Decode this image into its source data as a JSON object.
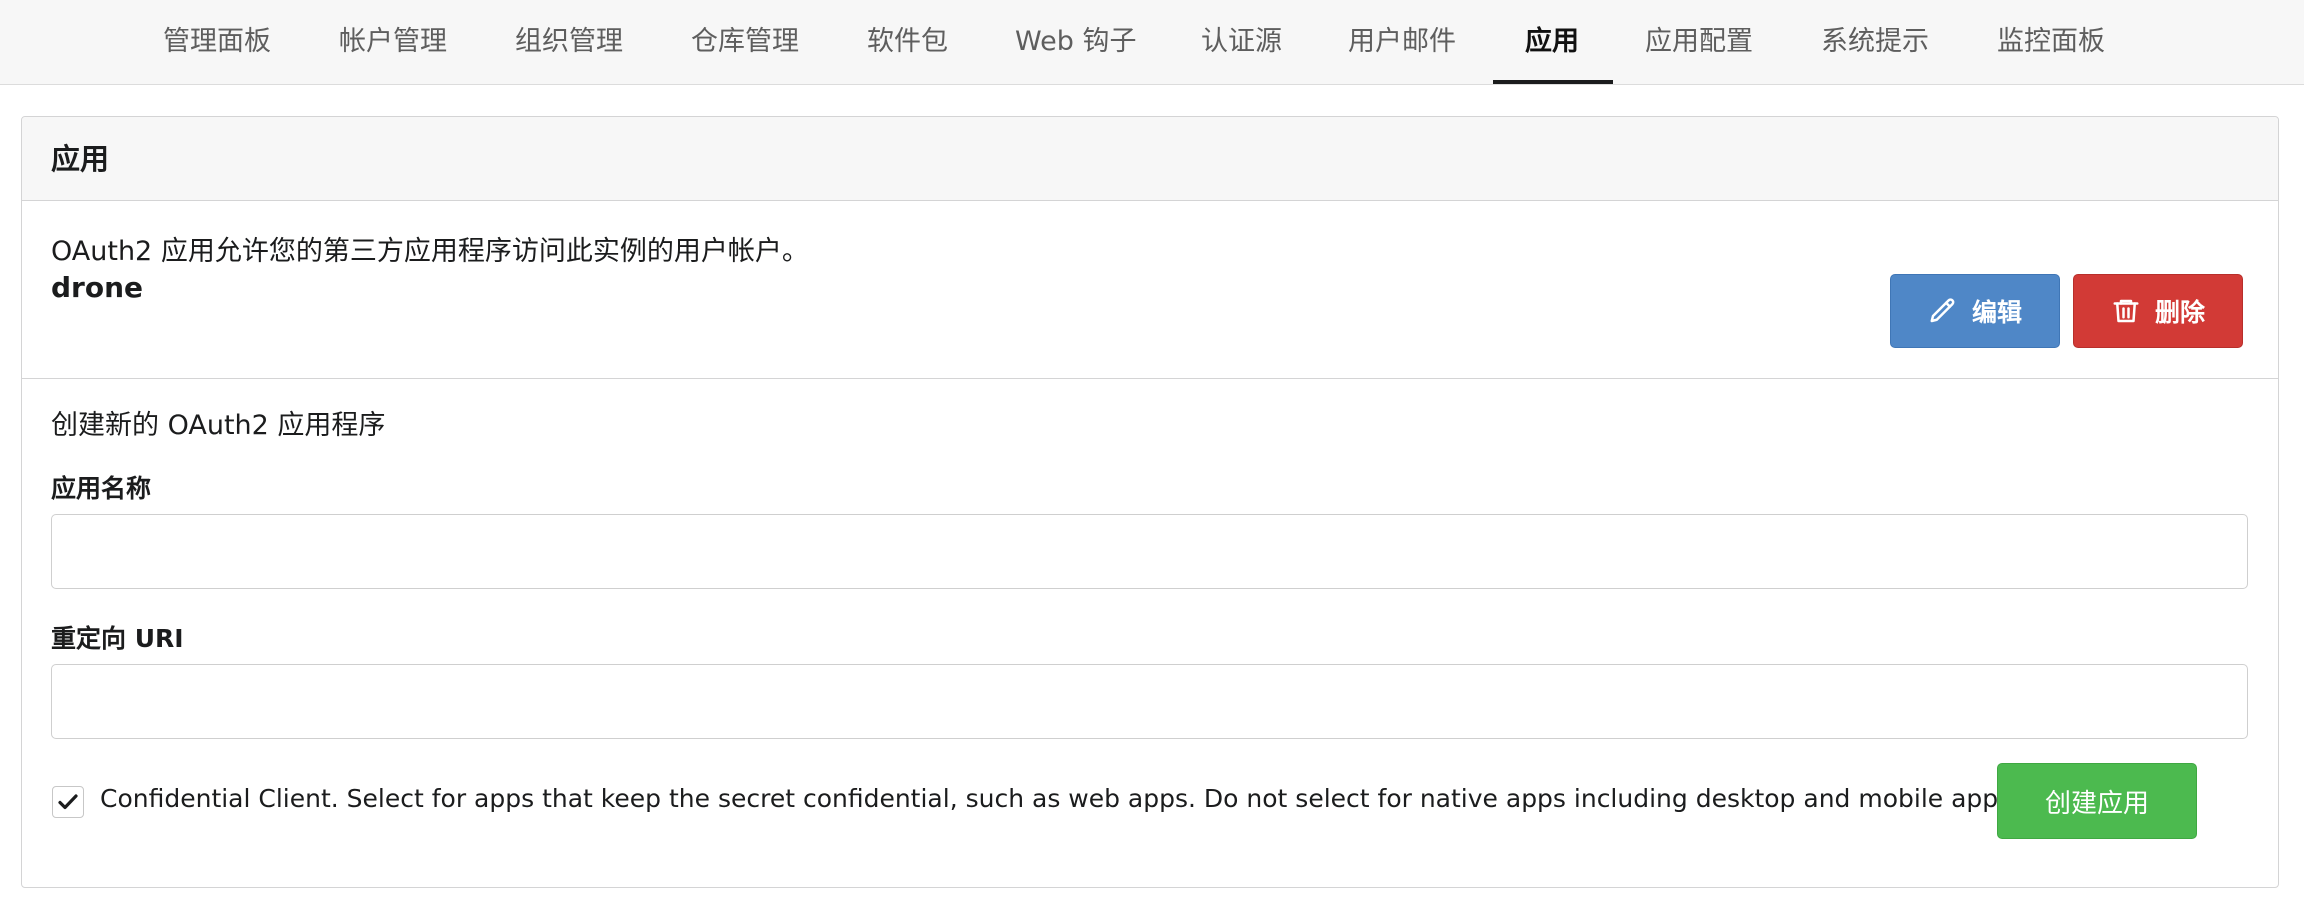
{
  "nav": {
    "items": [
      {
        "label": "管理面板",
        "active": false
      },
      {
        "label": "帐户管理",
        "active": false
      },
      {
        "label": "组织管理",
        "active": false
      },
      {
        "label": "仓库管理",
        "active": false
      },
      {
        "label": "软件包",
        "active": false
      },
      {
        "label": "Web 钩子",
        "active": false
      },
      {
        "label": "认证源",
        "active": false
      },
      {
        "label": "用户邮件",
        "active": false
      },
      {
        "label": "应用",
        "active": true
      },
      {
        "label": "应用配置",
        "active": false
      },
      {
        "label": "系统提示",
        "active": false
      },
      {
        "label": "监控面板",
        "active": false
      }
    ]
  },
  "panel": {
    "title": "应用",
    "description": "OAuth2 应用允许您的第三方应用程序访问此实例的用户帐户。",
    "app_name": "drone",
    "edit_label": "编辑",
    "delete_label": "删除"
  },
  "create_form": {
    "title": "创建新的 OAuth2 应用程序",
    "name_label": "应用名称",
    "name_value": "",
    "redirect_label": "重定向 URI",
    "redirect_value": "",
    "confidential_checked": true,
    "confidential_label": "Confidential Client. Select for apps that keep the secret confidential, such as web apps. Do not select for native apps including desktop and mobile apps.",
    "submit_label": "创建应用"
  },
  "colors": {
    "edit_button": "#4f87c7",
    "delete_button": "#d23a36",
    "create_button": "#4cba4f"
  },
  "icons": {
    "edit": "pencil-icon",
    "delete": "trash-icon",
    "checkbox": "checkmark-icon"
  }
}
